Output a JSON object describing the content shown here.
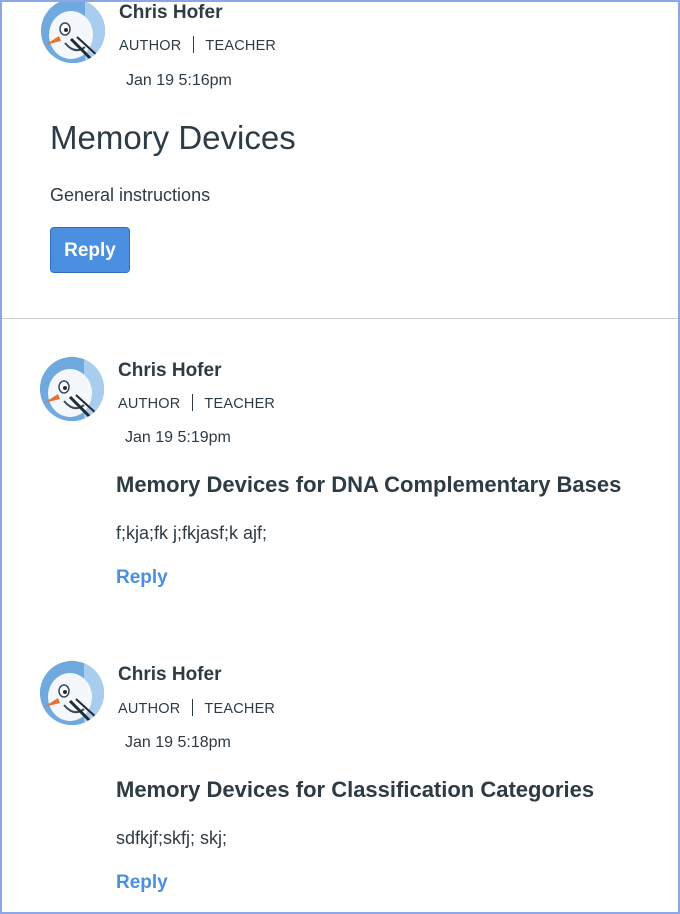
{
  "topic": {
    "author": {
      "name": "Chris Hofer",
      "roles": [
        "AUTHOR",
        "TEACHER"
      ],
      "avatar": "snowman-avatar"
    },
    "date": "Jan 19 5:16pm",
    "title": "Memory Devices",
    "body": "General instructions",
    "reply_label": "Reply"
  },
  "replies": [
    {
      "author": {
        "name": "Chris Hofer",
        "roles": [
          "AUTHOR",
          "TEACHER"
        ],
        "avatar": "snowman-avatar"
      },
      "date": "Jan 19 5:19pm",
      "title": "Memory Devices for DNA Complementary Bases",
      "body": "f;kja;fk j;fkjasf;k ajf;",
      "reply_label": "Reply"
    },
    {
      "author": {
        "name": "Chris Hofer",
        "roles": [
          "AUTHOR",
          "TEACHER"
        ],
        "avatar": "snowman-avatar"
      },
      "date": "Jan 19 5:18pm",
      "title": "Memory Devices for Classification Categories",
      "body": "sdfkjf;skfj; skj;",
      "reply_label": "Reply"
    }
  ],
  "colors": {
    "accent": "#4a8fe0",
    "text": "#2d3b45",
    "frame_border": "#8da6e8",
    "divider": "#c7cdd1"
  }
}
